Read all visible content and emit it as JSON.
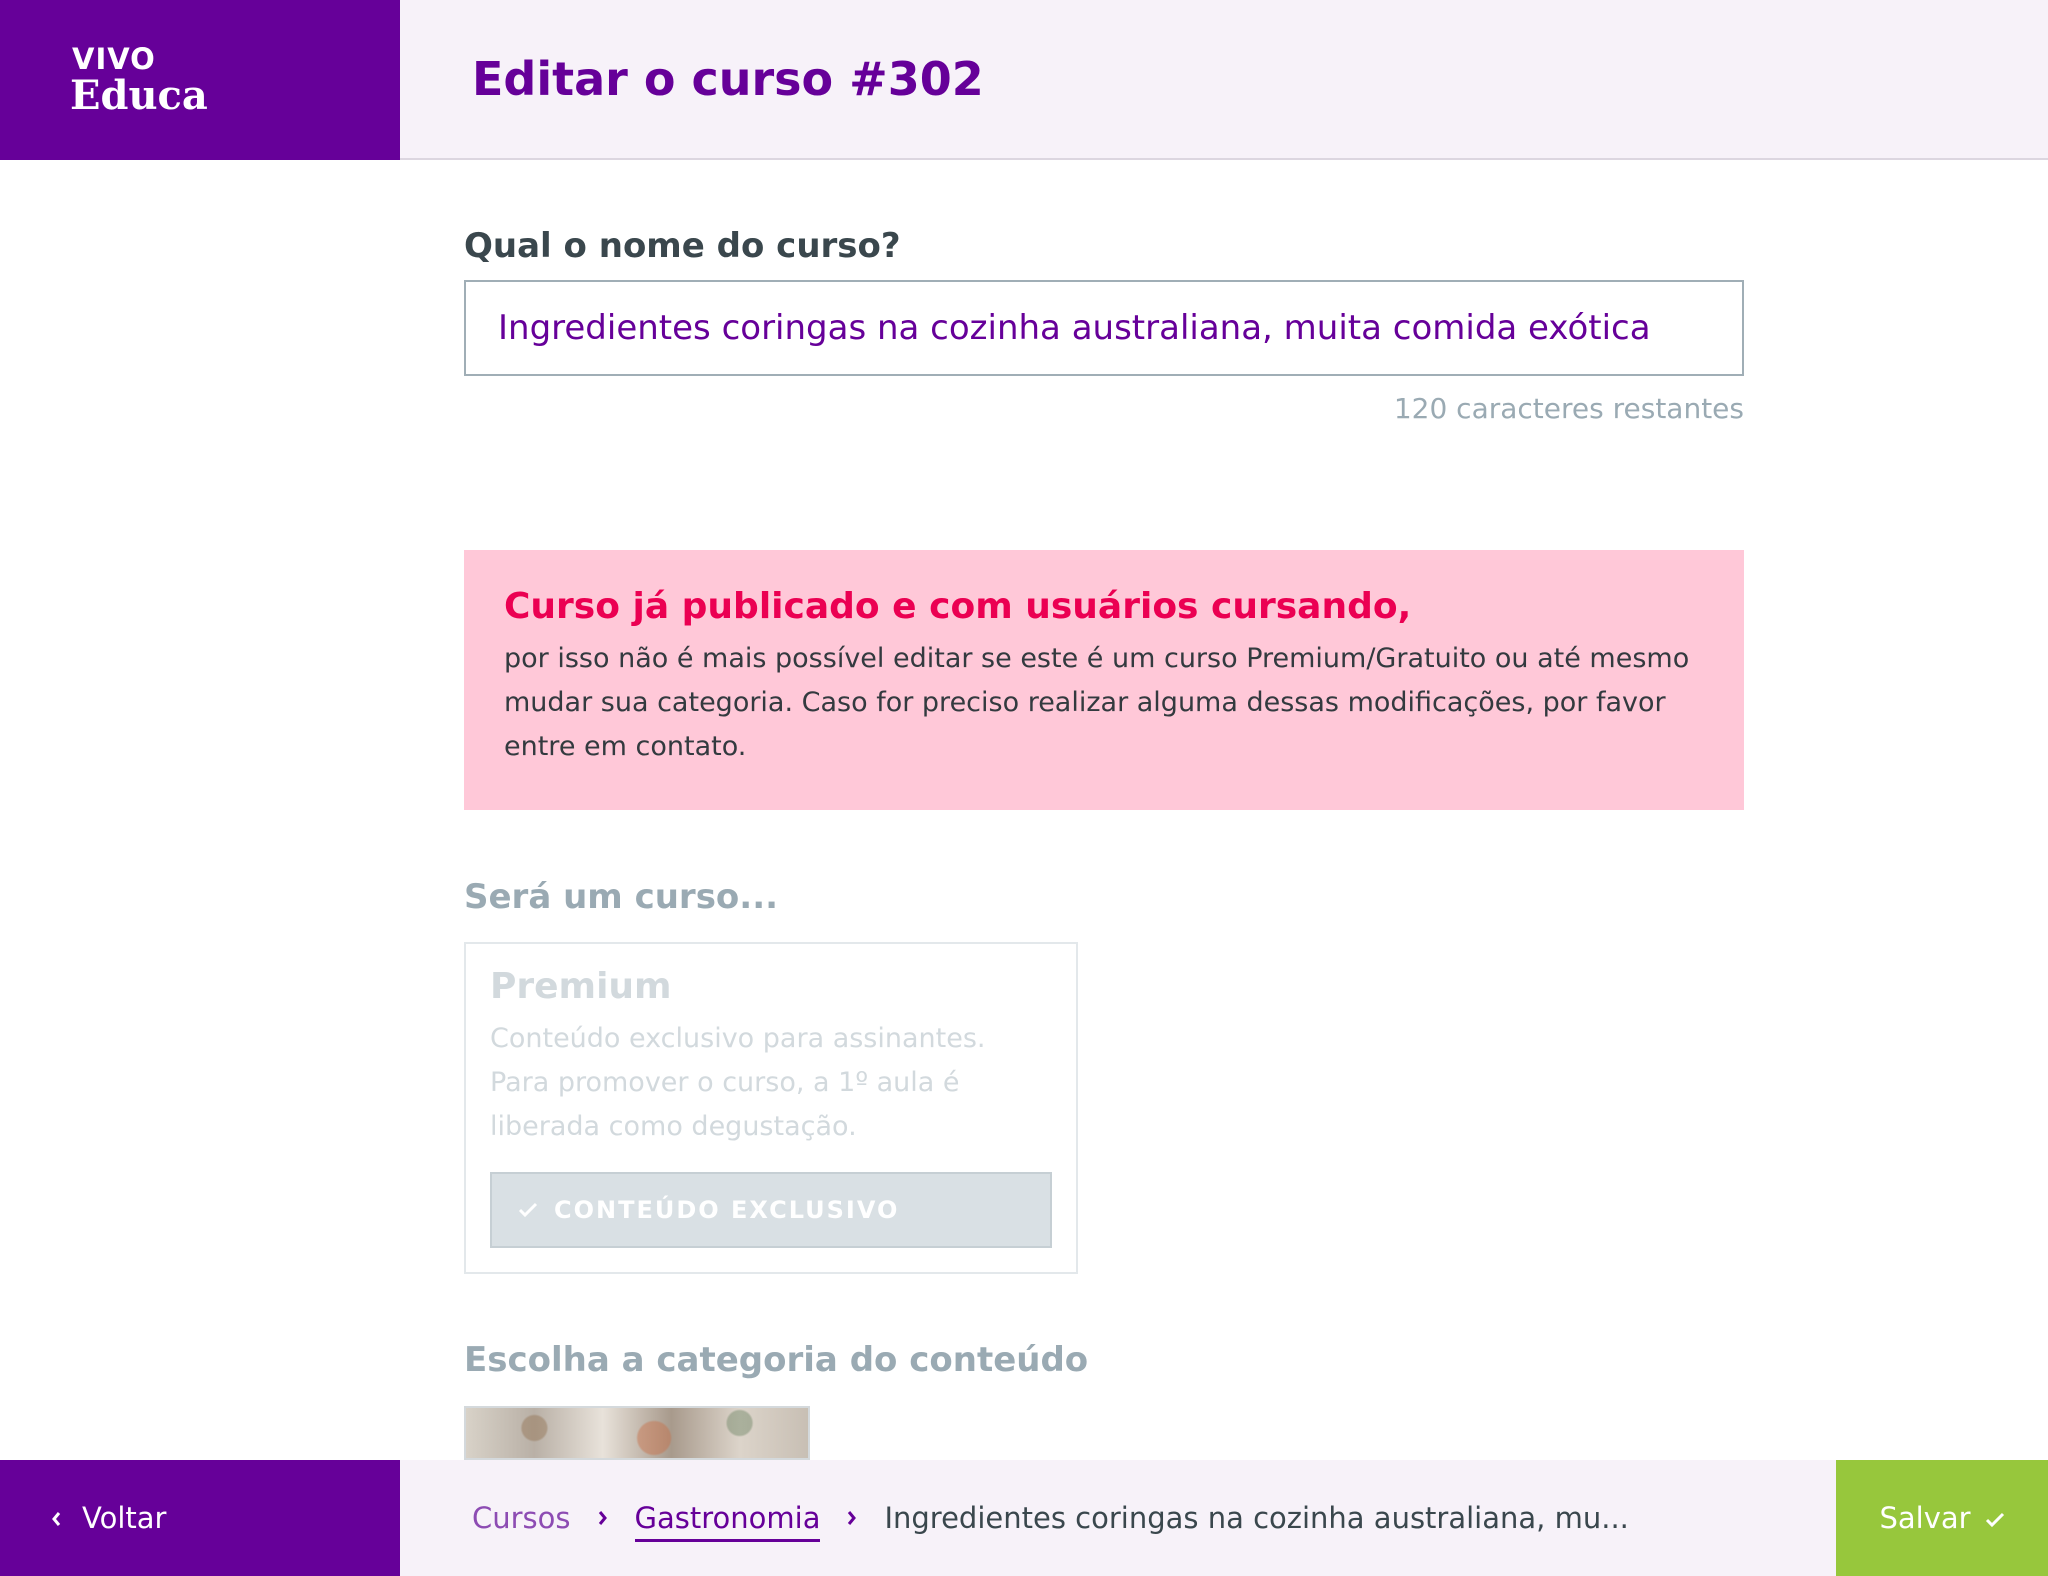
{
  "brand": {
    "line1": "VIVO",
    "line2": "Educa",
    "color": "#660099"
  },
  "header": {
    "title": "Editar o curso #302"
  },
  "course_name": {
    "label": "Qual o nome do curso?",
    "value": "Ingredientes coringas na cozinha australiana, muita comida exótica",
    "char_count": "120 caracteres restantes"
  },
  "alert": {
    "title": "Curso já publicado e com usuários cursando,",
    "body": "por isso não é mais possível editar se este é um curso Premium/Gratuito ou até mesmo mudar sua categoria. Caso for preciso realizar alguma dessas modificações, por favor entre em contato.",
    "color": "#eb0052",
    "background": "#ffc8d8"
  },
  "course_type": {
    "label": "Será um curso...",
    "option": {
      "title": "Premium",
      "description": "Conteúdo exclusivo para assinantes. Para promover o curso, a 1º aula é liberada como degustação.",
      "button_label": "CONTEÚDO EXCLUSIVO",
      "icon": "check-icon"
    }
  },
  "category": {
    "label": "Escolha a categoria do conteúdo"
  },
  "footer": {
    "back_label": "Voltar",
    "back_icon": "chevron-left-icon",
    "breadcrumb": [
      "Cursos",
      "Gastronomia",
      "Ingredientes coringas na cozinha australiana, mu..."
    ],
    "save_label": "Salvar",
    "save_icon": "check-icon",
    "save_color": "#97c73c"
  }
}
